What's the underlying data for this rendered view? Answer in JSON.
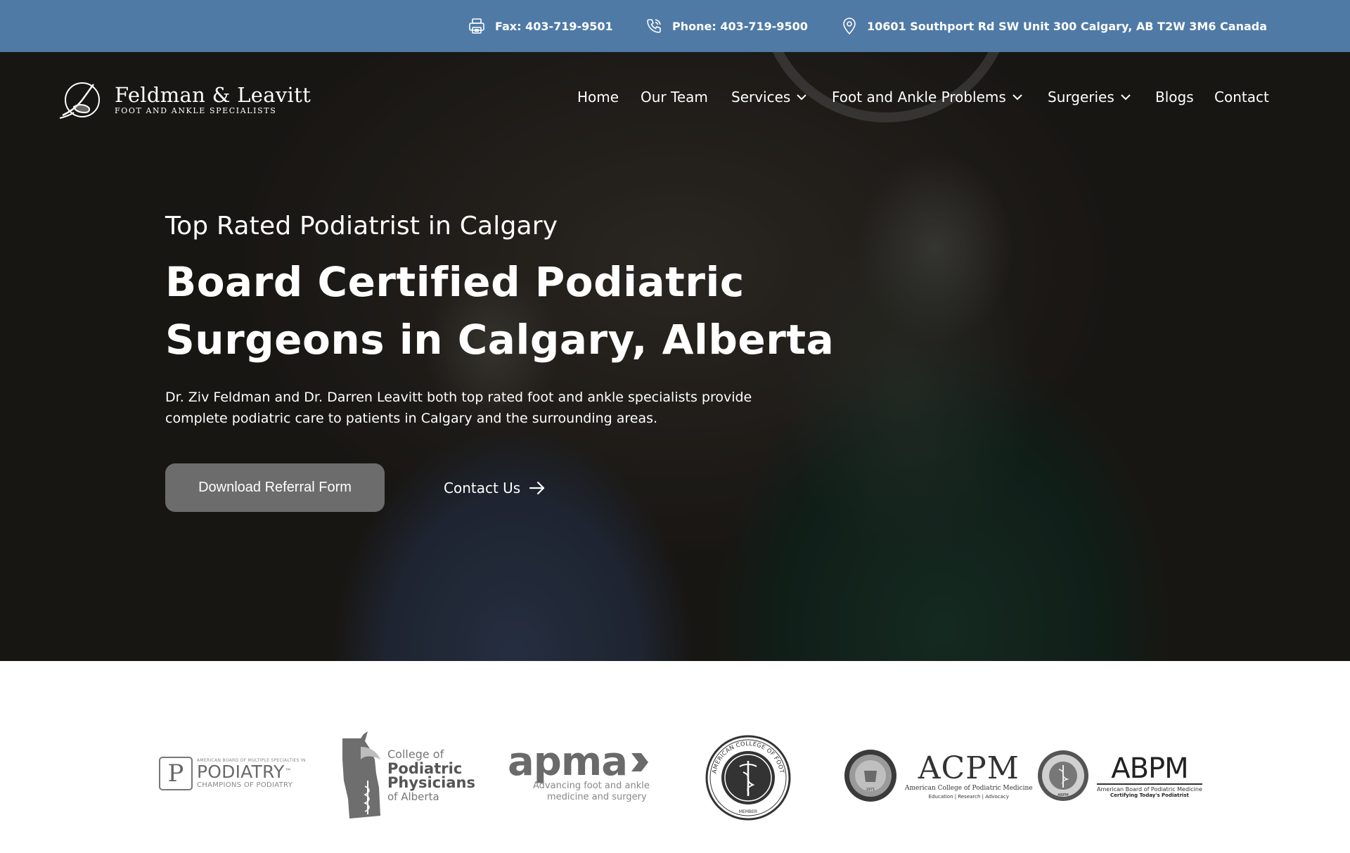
{
  "topbar": {
    "fax": "Fax: 403-719-9501",
    "phone": "Phone: 403-719-9500",
    "address": "10601 Southport Rd SW Unit 300 Calgary, AB T2W 3M6 Canada",
    "background": "#4f7aa6",
    "icons": [
      "fax-icon",
      "phone-icon",
      "map-pin-icon"
    ]
  },
  "logo": {
    "name": "Feldman & Leavitt",
    "subtitle": "FOOT AND ANKLE SPECIALISTS"
  },
  "nav": {
    "items": [
      {
        "label": "Home"
      },
      {
        "label": "Our Team"
      },
      {
        "label": "Services",
        "dropdown": true
      },
      {
        "label": "Foot and Ankle Problems",
        "dropdown": true
      },
      {
        "label": "Surgeries",
        "dropdown": true
      },
      {
        "label": "Blogs"
      },
      {
        "label": "Contact"
      }
    ]
  },
  "hero": {
    "eyebrow": "Top Rated Podiatrist in Calgary",
    "headline_line1": "Board Certified Podiatric",
    "headline_line2": "Surgeons in Calgary, Alberta",
    "description_line1": "Dr. Ziv Feldman and Dr. Darren Leavitt both top rated foot and ankle specialists provide",
    "description_line2": "complete podiatric care to patients in Calgary and the surrounding areas.",
    "primary_button": "Download Referral Form",
    "secondary_button": "Contact Us",
    "button_color": "#6c6c6c"
  },
  "affiliations": {
    "podiatry": {
      "small_top": "AMERICAN BOARD OF MULTIPLE SPECIALTIES IN",
      "main": "PODIATRY",
      "tm": "™",
      "bottom": "CHAMPIONS OF PODIATRY",
      "letter": "P"
    },
    "cpp": {
      "line1": "College of",
      "line2": "Podiatric",
      "line3": "Physicians",
      "line4": "of Alberta"
    },
    "apma": {
      "word": "apma",
      "tag_line1": "Advancing foot and ankle",
      "tag_line2": "medicine and surgery"
    },
    "acfas": {
      "ring": "AMERICAN COLLEGE OF FOOT AND ANKLE SURGEONS",
      "member": "MEMBER"
    },
    "acpm": {
      "abbr": "ACPM",
      "full": "American College of Podiatric Medicine",
      "tag": "Education | Research | Advocacy",
      "year": "1971"
    },
    "abpm": {
      "abbr": "ABPM",
      "full": "American Board of Podiatric Medicine",
      "tag": "Certifying Today's Podiatrist",
      "seal": "ABPM"
    }
  }
}
